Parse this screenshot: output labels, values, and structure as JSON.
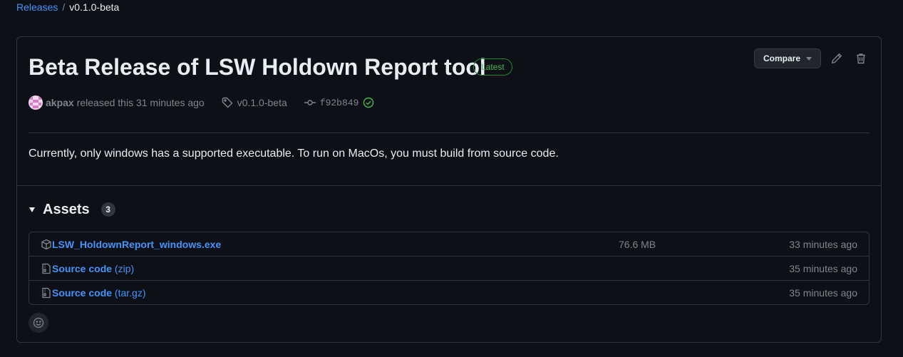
{
  "breadcrumb": {
    "parent": "Releases",
    "separator": "/",
    "current": "v0.1.0-beta"
  },
  "release": {
    "title": "Beta Release of LSW Holdown Report tool",
    "badge": "Latest",
    "compare_label": "Compare",
    "author": "akpax",
    "released_text": "released this 31 minutes ago",
    "tag": "v0.1.0-beta",
    "commit": "f92b849",
    "body": "Currently, only windows has a supported executable. To run on MacOs, you must build from source code."
  },
  "assets": {
    "title": "Assets",
    "count": "3",
    "items": [
      {
        "name": "LSW_HoldownReport_windows.exe",
        "suffix": "",
        "size": "76.6 MB",
        "time": "33 minutes ago",
        "icon": "package-icon"
      },
      {
        "name": "Source code",
        "suffix": "(zip)",
        "size": "",
        "time": "35 minutes ago",
        "icon": "file-zip-icon"
      },
      {
        "name": "Source code",
        "suffix": "(tar.gz)",
        "size": "",
        "time": "35 minutes ago",
        "icon": "file-zip-icon"
      }
    ]
  },
  "colors": {
    "background": "#0d1117",
    "border": "#30363d",
    "link": "#4493f8",
    "success": "#3fb950",
    "muted": "#7d8590"
  }
}
